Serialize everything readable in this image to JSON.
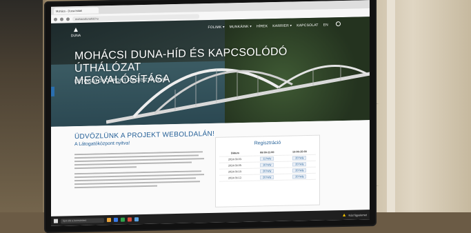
{
  "browser": {
    "tab_title": "Mohács - Duna-hidak",
    "url": "mohacsdunahid.hu"
  },
  "site": {
    "logo_text": "DUNA",
    "nav": [
      "FOLIMK ▾",
      "MUNKÁINK ▾",
      "HÍREK",
      "KARRIER ▾",
      "KAPCSOLAT",
      "EN"
    ],
    "hero_title_line1": "MOHÁCSI DUNA-HÍD ÉS KAPCSOLÓDÓ ÚTHÁLÓZAT",
    "hero_title_line2": "MEGVALÓSÍTÁSA",
    "hero_subtitle": "LÁTOGATÓKÖZPONT REGISZTRÁCIÓ",
    "welcome_title": "ÜDVÖZLÜNK A PROJEKT WEBOLDALÁN!",
    "welcome_sub": "A Látogatóközpont nyitva!"
  },
  "registration": {
    "title": "Regisztráció",
    "headers": [
      "Dátum",
      "09:00-11:00",
      "13:00-15:00"
    ],
    "rows": [
      [
        "2024.09.03.",
        "11 hely",
        "20 hely"
      ],
      [
        "2024.09.05.",
        "16 hely",
        "20 hely"
      ],
      [
        "2024.09.10.",
        "20 hely",
        "20 hely"
      ],
      [
        "2024.09.12.",
        "20 hely",
        "20 hely"
      ]
    ]
  },
  "taskbar": {
    "search_placeholder": "Írjon ide a kereséshez",
    "tray_text": "Kód figyelemet"
  },
  "colors": {
    "accent": "#1f5c95",
    "warning": "#f2c200"
  }
}
